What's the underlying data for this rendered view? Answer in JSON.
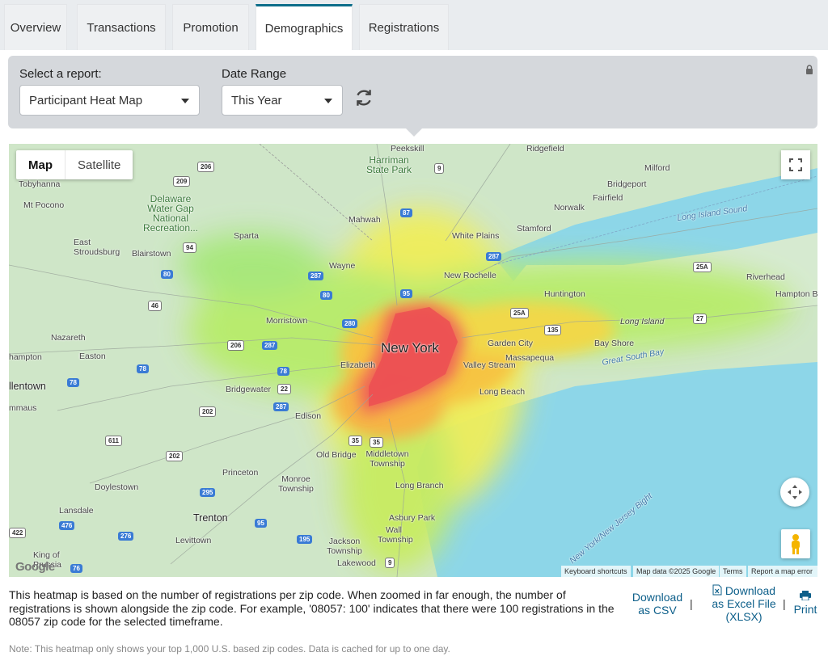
{
  "tabs": [
    {
      "label": "Overview",
      "active": false
    },
    {
      "label": "Transactions",
      "active": false
    },
    {
      "label": "Promotion",
      "active": false
    },
    {
      "label": "Demographics",
      "active": true
    },
    {
      "label": "Registrations",
      "active": false
    }
  ],
  "report": {
    "select_label": "Select a report:",
    "selected_report": "Participant Heat Map",
    "date_label": "Date Range",
    "selected_range": "This Year",
    "refresh_icon": "refresh-icon",
    "lock_icon": "lock-icon"
  },
  "map": {
    "type_buttons": {
      "map": "Map",
      "satellite": "Satellite"
    },
    "active_type": "Map",
    "labels": {
      "peekskill": "Peekskill",
      "ridgefield": "Ridgefield",
      "milford": "Milford",
      "harriman": "Harriman State Park",
      "bridgeport": "Bridgeport",
      "fairfield": "Fairfield",
      "norwalk": "Norwalk",
      "stamford": "Stamford",
      "tobyhanna": "Tobyhanna",
      "mtpocono": "Mt Pocono",
      "delaware": "Delaware Water Gap National Recreation...",
      "mahwah": "Mahwah",
      "sparta": "Sparta",
      "eaststroudsburg": "East Stroudsburg",
      "blairstown": "Blairstown",
      "whiteplains": "White Plains",
      "newrochelle": "New Rochelle",
      "wayne": "Wayne",
      "huntington": "Huntington",
      "riverhead": "Riverhead",
      "hamptonbays": "Hampton Bays",
      "longislandsound": "Long Island Sound",
      "morristown": "Morristown",
      "longisland": "Long Island",
      "nazareth": "Nazareth",
      "newyork": "New York",
      "gardencity": "Garden City",
      "bayshore": "Bay Shore",
      "easton": "Easton",
      "massapequa": "Massapequa",
      "greatsouthbay": "Great South Bay",
      "hampton": "hampton",
      "elizabeth": "Elizabeth",
      "valleystream": "Valley Stream",
      "allentown": "llentown",
      "bridgewater": "Bridgewater",
      "longbeach": "Long Beach",
      "emmaus": "mmaus",
      "edison": "Edison",
      "oldbridge": "Old Bridge",
      "middletown": "Middletown Township",
      "princeton": "Princeton",
      "doylestown": "Doylestown",
      "monroe": "Monroe Township",
      "longbranch": "Long Branch",
      "nyjbight": "New York/New Jersey Bight",
      "lansdale": "Lansdale",
      "trenton": "Trenton",
      "asburypark": "Asbury Park",
      "levittown": "Levittown",
      "wall": "Wall Township",
      "jackson": "Jackson Township",
      "kingofprussia": "King of Prussia",
      "lakewood": "Lakewood"
    },
    "shields": [
      "206",
      "209",
      "94",
      "80",
      "46",
      "287",
      "80",
      "280",
      "287",
      "206",
      "78",
      "78",
      "78",
      "22",
      "287",
      "202",
      "611",
      "202",
      "35",
      "35",
      "295",
      "95",
      "276",
      "476",
      "195",
      "76",
      "422",
      "9",
      "87",
      "287",
      "95",
      "25A",
      "25A",
      "135",
      "27",
      "9"
    ],
    "fullscreen_icon": "fullscreen-icon",
    "pan_icon": "pan-control-icon",
    "pegman_icon": "pegman-icon",
    "logo": "Google",
    "attribution": {
      "shortcuts": "Keyboard shortcuts",
      "data": "Map data ©2025 Google",
      "terms": "Terms",
      "report": "Report a map error"
    }
  },
  "footer": {
    "description": "This heatmap is based on the number of registrations per zip code. When zoomed in far enough, the number of registrations is shown alongside the zip code. For example, '08057: 100' indicates that there were 100 registrations in the 08057 zip code for the selected timeframe.",
    "download_csv": "Download as CSV",
    "download_excel_line1": "Download",
    "download_excel_line2": "as Excel File",
    "download_excel_line3": "(XLSX)",
    "print": "Print",
    "separator": "|",
    "note": "Note: This heatmap only shows your top 1,000 U.S. based zip codes. Data is cached for up to one day."
  }
}
